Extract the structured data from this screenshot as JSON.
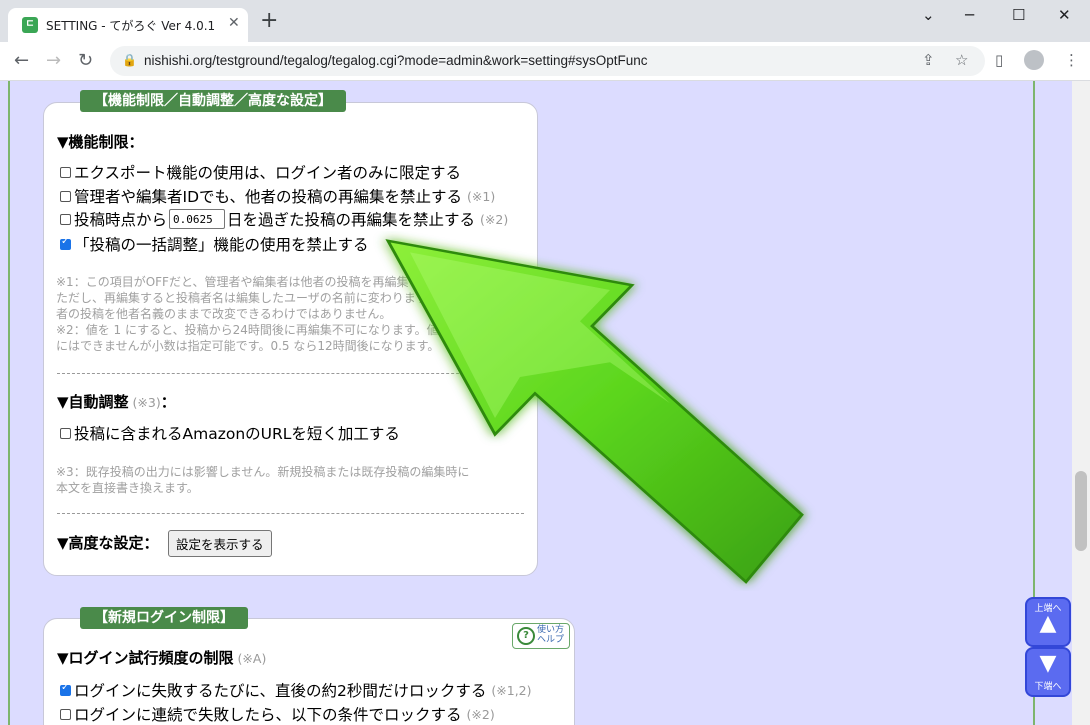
{
  "browser": {
    "tab_title": "SETTING - てがろぐ Ver 4.0.1",
    "tab_icon": "tegalog-favicon-icon",
    "new_tab": "+",
    "close_tab": "✕",
    "url": "nishishi.org/testground/tegalog/tegalog.cgi?mode=admin&work=setting#sysOptFunc",
    "win_min": "─",
    "win_max": "☐",
    "win_close": "✕",
    "back": "←",
    "forward": "→",
    "reload": "↻",
    "lock": "🔒",
    "share": "⇪",
    "star": "☆",
    "sidepanel": "▯",
    "menu": "⋮"
  },
  "section1": {
    "title": "【機能制限／自動調整／高度な設定】",
    "func_heading": "▼機能制限：",
    "options": [
      {
        "label": "エクスポート機能の使用は、ログイン者のみに限定する",
        "note": "",
        "checked": false
      },
      {
        "label": "管理者や編集者IDでも、他者の投稿の再編集を禁止する",
        "note": "(※1)",
        "checked": false
      },
      {
        "label_pre": "投稿時点から",
        "value": "0.0625",
        "label_post": "日を過ぎた投稿の再編集を禁止する",
        "note": "(※2)",
        "checked": false
      },
      {
        "label": "「投稿の一括調整」機能の使用を禁止する",
        "note": "",
        "checked": true
      }
    ],
    "notes1": [
      "※1：この項目がOFFだと、管理者や編集者は他者の投稿を再編集できます。",
      "ただし、再編集すると投稿者名は編集したユーザの名前に変わりますから、他",
      "者の投稿を他者名義のままで改変できるわけではありません。",
      "※2：値を 1 にすると、投稿から24時間後に再編集不可になります。値は 0",
      "にはできませんが小数は指定可能です。0.5 なら12時間後になります。"
    ],
    "auto_heading": "▼自動調整",
    "auto_heading_note": "(※3)",
    "auto_heading_colon": "：",
    "auto_option": {
      "label": "投稿に含まれるAmazonのURLを短く加工する",
      "checked": false
    },
    "notes3": [
      "※3：既存投稿の出力には影響しません。新規投稿または既存投稿の編集時に",
      "本文を直接書き換えます。"
    ],
    "adv_heading": "▼高度な設定：",
    "adv_button": "設定を表示する"
  },
  "section2": {
    "title": "【新規ログイン制限】",
    "help_label_1": "使い方",
    "help_label_2": "ヘルプ",
    "help_icon": "help-question-icon",
    "heading": "▼ログイン試行頻度の制限",
    "heading_note": "(※A)",
    "options": [
      {
        "label": "ログインに失敗するたびに、直後の約2秒間だけロックする",
        "note": "(※1,2)",
        "checked": true
      },
      {
        "label": "ログインに連続で失敗したら、以下の条件でロックする",
        "note": "(※2)",
        "checked": false
      }
    ]
  },
  "float_nav": {
    "up_label": "上端へ",
    "down_label": "下端へ",
    "up_icon": "▲",
    "down_icon": "▼"
  },
  "overlay": {
    "arrow": "green-pointer-arrow-icon",
    "arrow_color": "#5cd61e"
  }
}
